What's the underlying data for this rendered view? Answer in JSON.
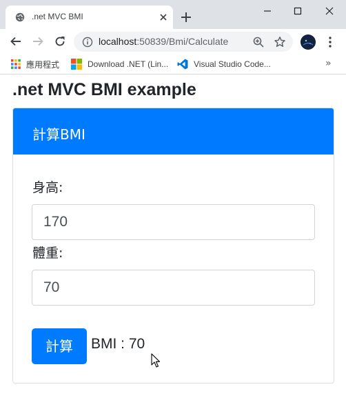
{
  "browser": {
    "tab_title": ".net MVC BMI",
    "url_host": "localhost",
    "url_path": ":50839/Bmi/Calculate",
    "bookmarks": [
      {
        "label": "應用程式",
        "icon": "apps-grid-icon"
      },
      {
        "label": "Download .NET (Lin...",
        "icon": "windows-logo-icon"
      },
      {
        "label": "Visual Studio Code...",
        "icon": "vscode-icon"
      }
    ],
    "more_bookmarks": "»"
  },
  "page": {
    "title": ".net MVC BMI example",
    "card_header": "計算BMI",
    "height_label": "身高:",
    "height_value": "170",
    "weight_label": "體重:",
    "weight_value": "70",
    "submit_label": "計算",
    "result_text": "BMI : 70"
  },
  "colors": {
    "primary": "#007bff",
    "chrome_bg": "#dee1e6",
    "text": "#212529"
  }
}
